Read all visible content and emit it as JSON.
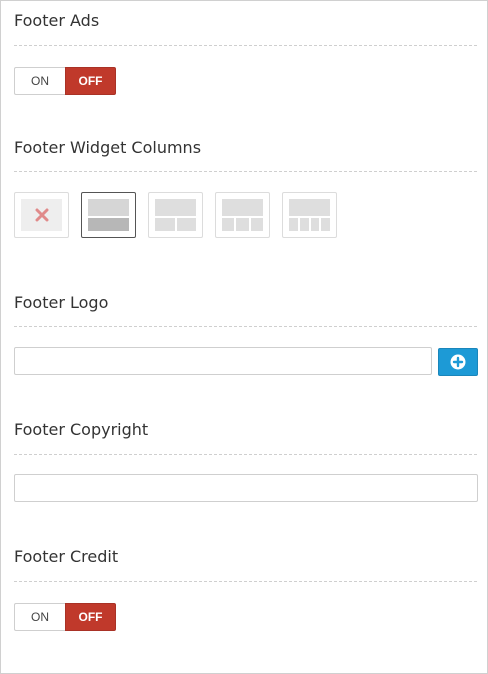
{
  "sections": {
    "footer_ads": {
      "title": "Footer Ads",
      "toggle": {
        "on_label": "ON",
        "off_label": "OFF",
        "value": "OFF"
      }
    },
    "footer_widget_columns": {
      "title": "Footer Widget Columns",
      "options": [
        {
          "name": "none",
          "icon": "remove-x-icon"
        },
        {
          "name": "1-column",
          "columns": 1,
          "selected": true
        },
        {
          "name": "2-columns",
          "columns": 2
        },
        {
          "name": "3-columns",
          "columns": 3
        },
        {
          "name": "4-columns",
          "columns": 4
        }
      ]
    },
    "footer_logo": {
      "title": "Footer Logo",
      "input_value": "",
      "add_button_icon": "plus-circle-icon"
    },
    "footer_copyright": {
      "title": "Footer Copyright",
      "input_value": ""
    },
    "footer_credit": {
      "title": "Footer Credit",
      "toggle": {
        "on_label": "ON",
        "off_label": "OFF",
        "value": "OFF"
      }
    }
  },
  "colors": {
    "toggle_off": "#c0392b",
    "add_button": "#1d9ad6",
    "remove_x": "#e08a8a"
  }
}
